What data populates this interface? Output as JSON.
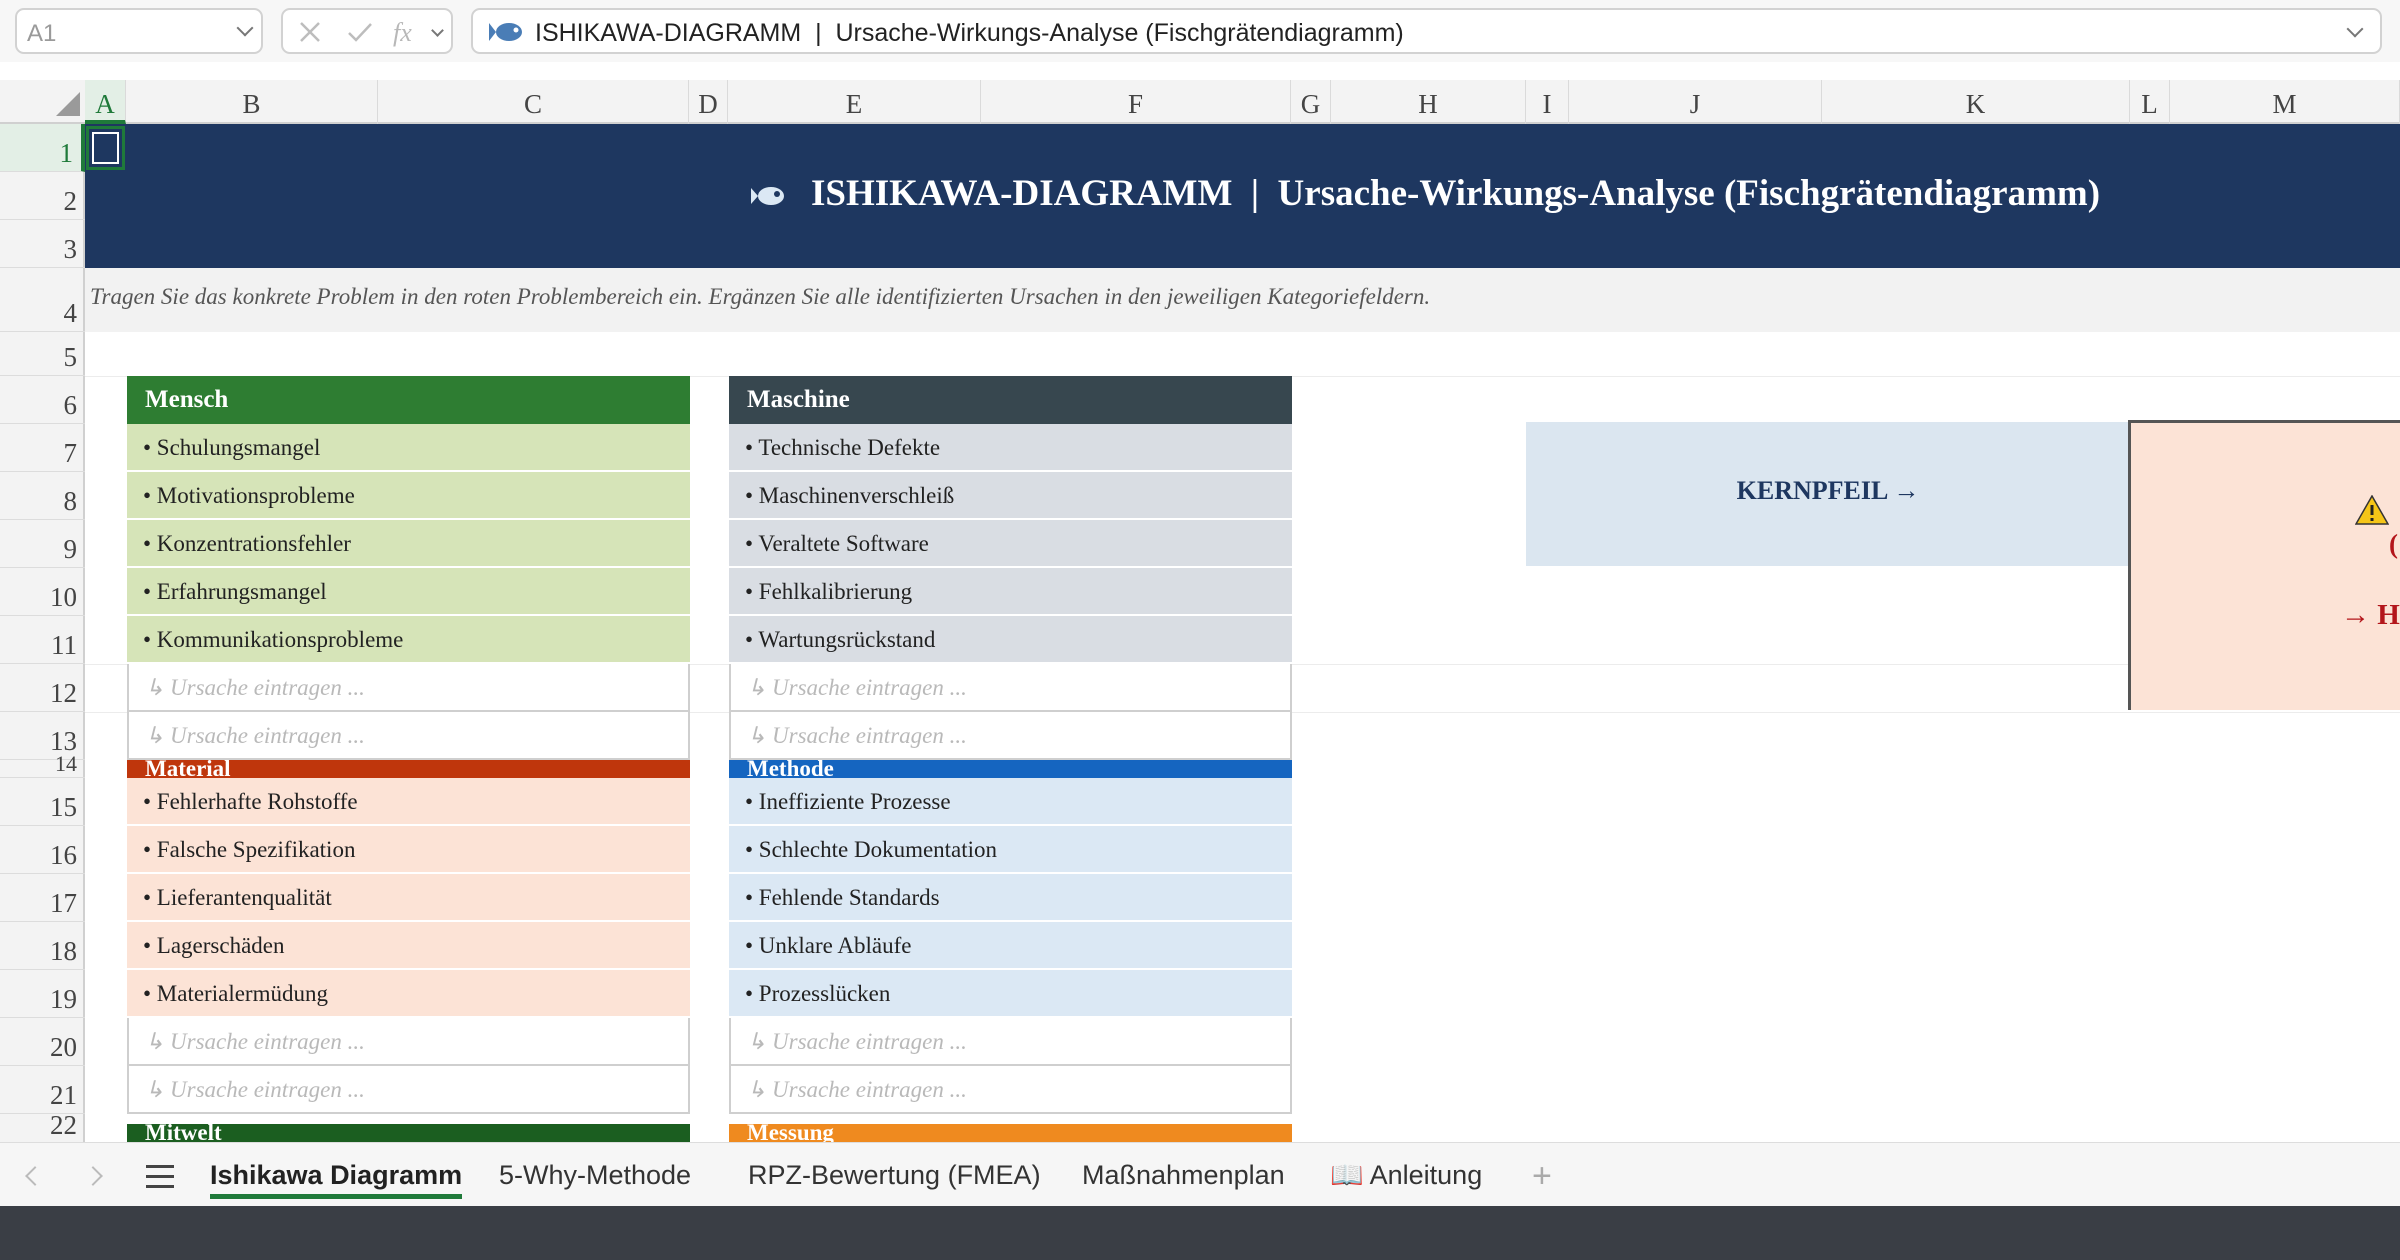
{
  "formula_bar": {
    "name_box": "A1",
    "fx_label": "fx",
    "formula": "ISHIKAWA-DIAGRAMM  |  Ursache-Wirkungs-Analyse (Fischgrätendiagramm)"
  },
  "columns": [
    "A",
    "B",
    "C",
    "D",
    "E",
    "F",
    "G",
    "H",
    "I",
    "J",
    "K",
    "L",
    "M"
  ],
  "rows": [
    "1",
    "2",
    "3",
    "4",
    "5",
    "6",
    "7",
    "8",
    "9",
    "10",
    "11",
    "12",
    "13",
    "14",
    "15",
    "16",
    "17",
    "18",
    "19",
    "20",
    "21",
    "22"
  ],
  "sheet": {
    "title": "ISHIKAWA-DIAGRAMM  |  Ursache-Wirkungs-Analyse (Fischgrätendiagramm)",
    "instruction": "Tragen Sie das konkrete Problem in den roten Problembereich ein. Ergänzen Sie alle identifizierten Ursachen in den jeweiligen Kategoriefeldern.",
    "categories": [
      {
        "name": "Mensch",
        "header_color": "#2e7d32",
        "fill_color": "#d6e4b8",
        "items": [
          "• Schulungsmangel",
          "• Motivationsprobleme",
          "• Konzentrationsfehler",
          "• Erfahrungsmangel",
          "• Kommunikationsprobleme"
        ],
        "placeholders": [
          "↳ Ursache eintragen ...",
          "↳ Ursache eintragen ..."
        ]
      },
      {
        "name": "Maschine",
        "header_color": "#37474f",
        "fill_color": "#d9dde3",
        "items": [
          "• Technische Defekte",
          "• Maschinenverschleiß",
          "• Veraltete Software",
          "• Fehlkalibrierung",
          "• Wartungsrückstand"
        ],
        "placeholders": [
          "↳ Ursache eintragen ...",
          "↳ Ursache eintragen ..."
        ]
      },
      {
        "name": "Material",
        "header_color": "#bf360c",
        "fill_color": "#fce3d6",
        "items": [
          "• Fehlerhafte Rohstoffe",
          "• Falsche Spezifikation",
          "• Lieferantenqualität",
          "• Lagerschäden",
          "• Materialermüdung"
        ],
        "placeholders": [
          "↳ Ursache eintragen ...",
          "↳ Ursache eintragen ..."
        ]
      },
      {
        "name": "Methode",
        "header_color": "#1565c0",
        "fill_color": "#dbe8f4",
        "items": [
          "• Ineffiziente Prozesse",
          "• Schlechte Dokumentation",
          "• Fehlende Standards",
          "• Unklare Abläufe",
          "• Prozesslücken"
        ],
        "placeholders": [
          "↳ Ursache eintragen ...",
          "↳ Ursache eintragen ..."
        ]
      },
      {
        "name": "Mitwelt",
        "header_color": "#1b5e20"
      },
      {
        "name": "Messung",
        "header_color": "#ef8a1f"
      }
    ],
    "kernpfeil": "KERNPFEIL →",
    "problem_line1": "(",
    "problem_line2": "→ H"
  },
  "tabs": [
    "Ishikawa Diagramm",
    "5-Why-Methode",
    "RPZ-Bewertung (FMEA)",
    "Maßnahmenplan",
    "📖 Anleitung"
  ],
  "active_tab": "Ishikawa Diagramm",
  "colors": {
    "title_band": "#1e3760",
    "selection": "#1f7a3a",
    "problem_text": "#b3161b"
  }
}
